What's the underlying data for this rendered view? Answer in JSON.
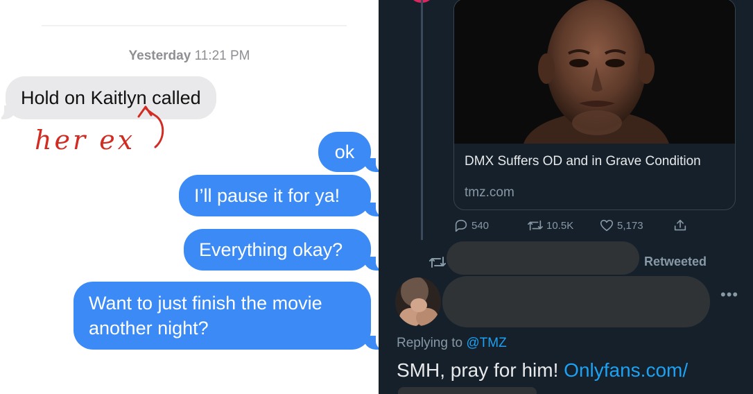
{
  "imessage": {
    "timestamp_day": "Yesterday",
    "timestamp_time": "11:21 PM",
    "messages": [
      {
        "from": "them",
        "text": "Hold on Kaitlyn called"
      },
      {
        "from": "me",
        "text": "ok"
      },
      {
        "from": "me",
        "text": "I’ll pause it for ya!"
      },
      {
        "from": "me",
        "text": "Everything okay?"
      },
      {
        "from": "me",
        "text": "Want to just finish the movie another night?"
      }
    ],
    "annotation": "her ex",
    "colors": {
      "outgoing": "#3b8af6",
      "incoming": "#e9e9eb",
      "annotation": "#d12b22"
    }
  },
  "tweet_thread": {
    "link_card": {
      "title": "DMX Suffers OD and in Grave Condition",
      "domain": "tmz.com",
      "image": "photo of bald man looking worried"
    },
    "actions": {
      "replies": "540",
      "retweets": "10.5K",
      "likes": "5,173"
    },
    "retweeted_label": "Retweeted",
    "reply": {
      "replying_prefix": "Replying to",
      "replying_handle": "@TMZ",
      "text": "SMH, pray for him!",
      "link": "Onlyfans.com/"
    },
    "colors": {
      "background": "#15202b",
      "link": "#1da1f2",
      "muted": "#8899a6",
      "text": "#e7e9ea"
    }
  }
}
